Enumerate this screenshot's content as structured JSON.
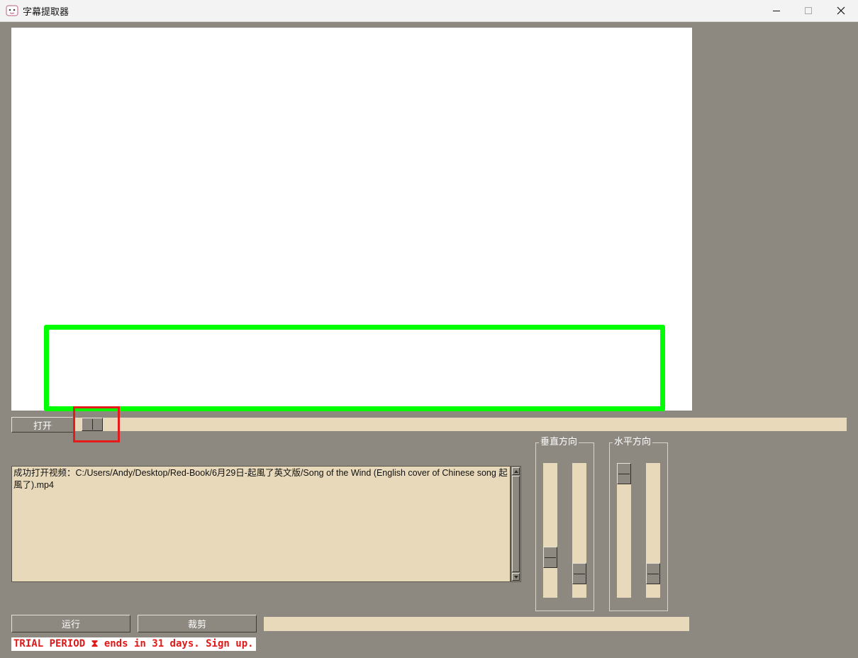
{
  "window": {
    "title": "字幕提取器",
    "controls": [
      "minimize-icon",
      "maximize-icon",
      "close-icon"
    ]
  },
  "toolbar": {
    "open_label": "打开",
    "progress": 0.01
  },
  "log": {
    "text": "成功打开视频：C:/Users/Andy/Desktop/Red-Book/6月29日-起風了英文版/Song of the Wind (English cover of Chinese song 起風了).mp4"
  },
  "vertical": {
    "title": "垂直方向",
    "slider_start": 0.74,
    "slider_end": 0.88
  },
  "horizontal": {
    "title": "水平方向",
    "slider_start": 0.0,
    "slider_end": 0.88
  },
  "actions": {
    "run_label": "运行",
    "crop_label": "裁剪"
  },
  "trial_banner": "TRIAL PERIOD ⧗ ends in 31 days. Sign up.",
  "colors": {
    "background": "#8d8980",
    "field": "#e8d9bb",
    "selection_box": "#00ff00",
    "highlight": "#e51b1b",
    "trial_text": "#e01818"
  }
}
